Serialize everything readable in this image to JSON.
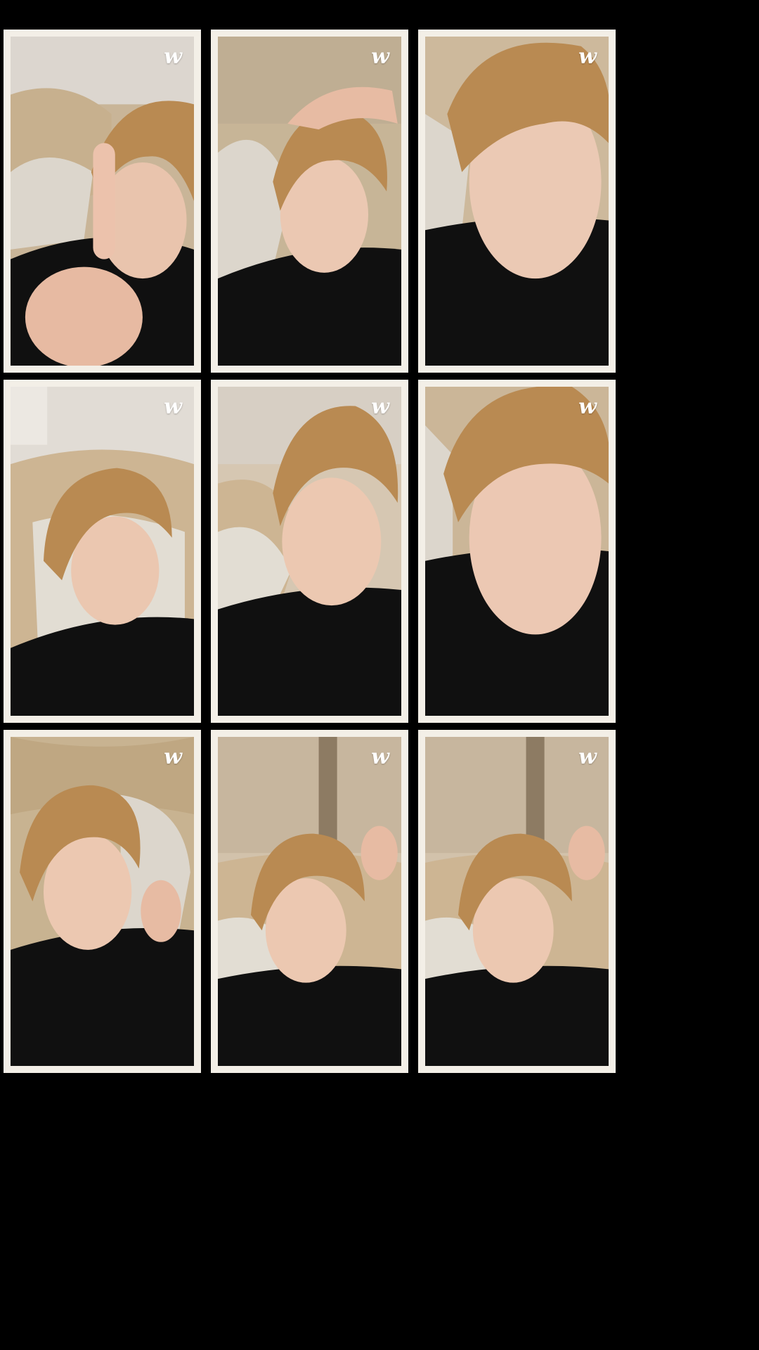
{
  "collage": {
    "frames": [
      {
        "logo": "w",
        "pose": "finger-raised"
      },
      {
        "logo": "w",
        "pose": "hand-on-head"
      },
      {
        "logo": "w",
        "pose": "close-up-face"
      },
      {
        "logo": "w",
        "pose": "lying-on-pillow"
      },
      {
        "logo": "w",
        "pose": "smiling"
      },
      {
        "logo": "w",
        "pose": "close-up-tongue"
      },
      {
        "logo": "w",
        "pose": "hand-gesture"
      },
      {
        "logo": "w",
        "pose": "pout-with-peace-sign"
      },
      {
        "logo": "w",
        "pose": "pout-looking-aside"
      }
    ]
  },
  "colors": {
    "background": "#000000",
    "frame_border": "#f3efe7",
    "hair": "#b98a52",
    "skin": "#e9c4ad",
    "shirt": "#101010",
    "couch": "#cdb89a",
    "pillow": "#dcd6cc",
    "logo": "#ffffff"
  }
}
